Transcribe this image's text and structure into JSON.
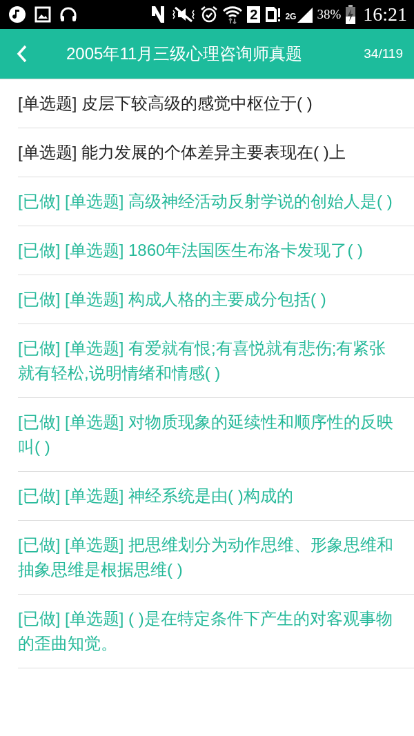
{
  "status_bar": {
    "sim": "2",
    "network": "2G",
    "battery": "38%",
    "time": "16:21"
  },
  "header": {
    "title": "2005年11月三级心理咨询师真题",
    "count": "34/119"
  },
  "questions": [
    {
      "text": "[单选题] 皮层下较高级的感觉中枢位于( )",
      "done": false
    },
    {
      "text": "[单选题] 能力发展的个体差异主要表现在( )上",
      "done": false
    },
    {
      "text": "[已做] [单选题] 高级神经活动反射学说的创始人是( )",
      "done": true
    },
    {
      "text": "[已做] [单选题] 1860年法国医生布洛卡发现了( )",
      "done": true
    },
    {
      "text": "[已做] [单选题] 构成人格的主要成分包括( )",
      "done": true
    },
    {
      "text": "[已做] [单选题] 有爱就有恨;有喜悦就有悲伤;有紧张就有轻松,说明情绪和情感( )",
      "done": true
    },
    {
      "text": "[已做] [单选题] 对物质现象的延续性和顺序性的反映叫( )",
      "done": true
    },
    {
      "text": "[已做] [单选题] 神经系统是由( )构成的",
      "done": true
    },
    {
      "text": "[已做] [单选题] 把思维划分为动作思维、形象思维和抽象思维是根据思维( )",
      "done": true
    },
    {
      "text": "[已做] [单选题] ( )是在特定条件下产生的对客观事物的歪曲知觉。",
      "done": true
    }
  ]
}
